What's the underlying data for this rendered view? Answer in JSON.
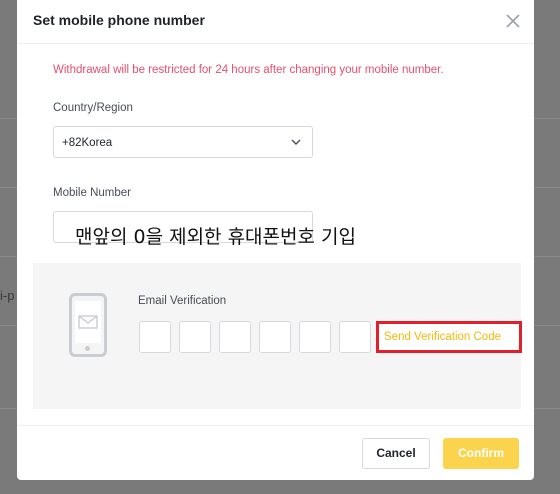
{
  "dialog": {
    "title": "Set mobile phone number",
    "warning": "Withdrawal will be restricted for 24 hours after changing your mobile number."
  },
  "country": {
    "label": "Country/Region",
    "value": "+82Korea"
  },
  "mobile": {
    "label": "Mobile Number",
    "overlay_note": "맨앞의 0을 제외한 휴대폰번호 기입"
  },
  "email_verification": {
    "label": "Email Verification",
    "send_code_label": "Send Verification Code"
  },
  "buttons": {
    "cancel": "Cancel",
    "confirm": "Confirm"
  },
  "background": {
    "partial_left": "i-p"
  },
  "colors": {
    "warning": "#e84e6e",
    "accent": "#f0b90b",
    "confirm_bg": "#fcd34d",
    "highlight_box": "#e0202a"
  },
  "icons": [
    "close-icon",
    "chevron-down-icon",
    "mobile-phone-icon",
    "envelope-icon"
  ]
}
